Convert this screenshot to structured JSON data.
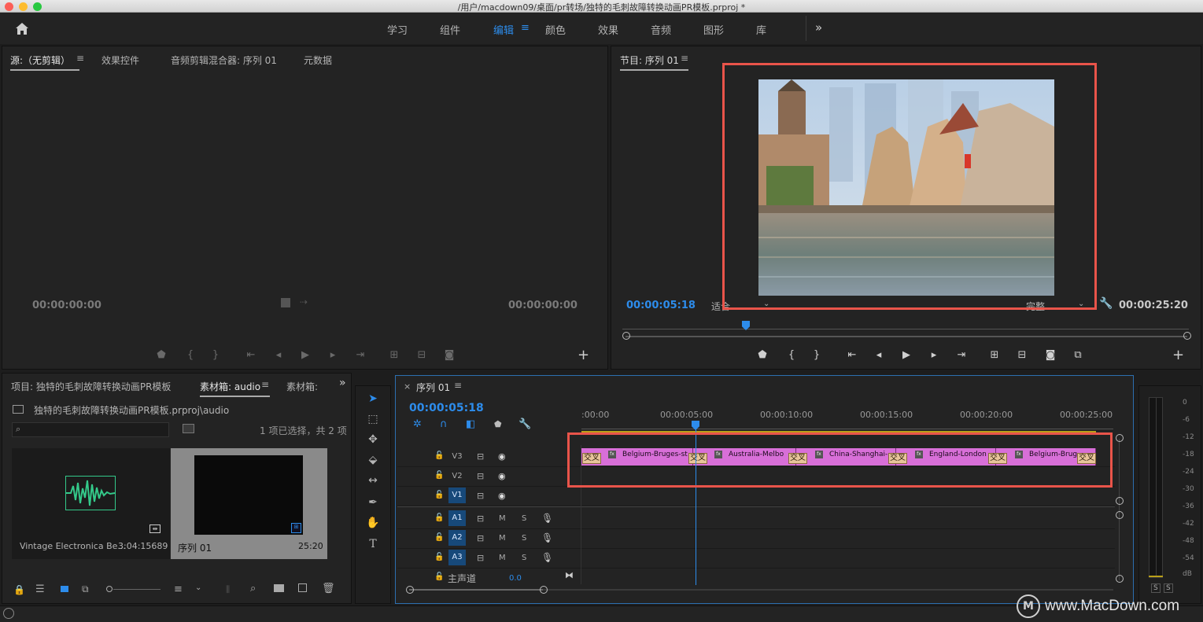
{
  "window": {
    "title": "/用户/macdown09/桌面/pr转场/独特的毛刺故障转换动画PR模板.prproj *"
  },
  "workspaces": {
    "tabs": [
      "学习",
      "组件",
      "编辑",
      "颜色",
      "效果",
      "音频",
      "图形",
      "库"
    ],
    "active": "编辑",
    "overflow": "»"
  },
  "source_panel": {
    "tabs": [
      "源:（无剪辑）",
      "效果控件",
      "音频剪辑混合器: 序列 01",
      "元数据"
    ],
    "tc_left": "00:00:00:00",
    "tc_right": "00:00:00:00"
  },
  "program_monitor": {
    "title": "节目: 序列 01",
    "tc_current": "00:00:05:18",
    "tc_duration": "00:00:25:20",
    "fit": "适合",
    "quality": "完整"
  },
  "project_panel": {
    "tabs": [
      "项目: 独特的毛刺故障转换动画PR模板",
      "素材箱: audio",
      "素材箱:"
    ],
    "path": "独特的毛刺故障转换动画PR模板.prproj\\audio",
    "selection_info": "1 项已选择，共 2 项",
    "items": [
      {
        "name": "Vintage Electronica Be...",
        "duration": "3:04:15689"
      },
      {
        "name": "序列 01",
        "duration": "25:20"
      }
    ]
  },
  "timeline": {
    "tab": "序列 01",
    "timecode": "00:00:05:18",
    "ruler": [
      ":00:00",
      "00:00:05:00",
      "00:00:10:00",
      "00:00:15:00",
      "00:00:20:00",
      "00:00:25:00"
    ],
    "video_tracks": [
      "V3",
      "V2",
      "V1"
    ],
    "audio_tracks": [
      "A1",
      "A2",
      "A3"
    ],
    "master_label": "主声道",
    "master_value": "0.0",
    "mute_label": "M",
    "solo_label": "S",
    "transition_label": "交叉",
    "clips": [
      "Belgium-Bruges-st",
      "Australia-Melbo",
      "China-Shanghai-",
      "England-London",
      "Belgium-Brug"
    ]
  },
  "audio_meter": {
    "scale": [
      "0",
      "-6",
      "-12",
      "-18",
      "-24",
      "-30",
      "-36",
      "-42",
      "-48",
      "-54",
      "dB"
    ],
    "solo": [
      "S",
      "S"
    ]
  },
  "watermark": "www.MacDown.com",
  "colors": {
    "accent": "#2d8ceb",
    "highlight": "#e9544a",
    "clip": "#d86fd8"
  }
}
